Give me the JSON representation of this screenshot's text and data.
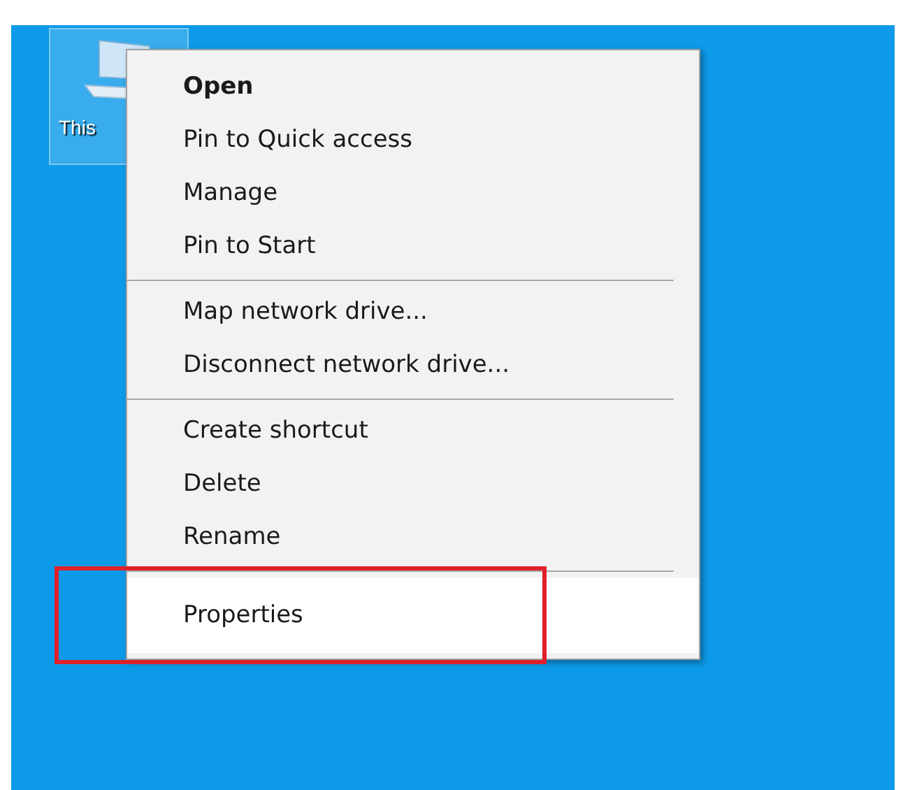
{
  "desktop_icon": {
    "label": "This",
    "selected": true
  },
  "context_menu": {
    "items": [
      {
        "kind": "item",
        "label": "Open",
        "default": true,
        "selected": false,
        "annotated": false
      },
      {
        "kind": "item",
        "label": "Pin to Quick access",
        "default": false,
        "selected": false,
        "annotated": false
      },
      {
        "kind": "item",
        "label": "Manage",
        "default": false,
        "selected": false,
        "annotated": false
      },
      {
        "kind": "item",
        "label": "Pin to Start",
        "default": false,
        "selected": false,
        "annotated": false
      },
      {
        "kind": "separator"
      },
      {
        "kind": "item",
        "label": "Map network drive...",
        "default": false,
        "selected": false,
        "annotated": false
      },
      {
        "kind": "item",
        "label": "Disconnect network drive...",
        "default": false,
        "selected": false,
        "annotated": false
      },
      {
        "kind": "separator"
      },
      {
        "kind": "item",
        "label": "Create shortcut",
        "default": false,
        "selected": false,
        "annotated": false
      },
      {
        "kind": "item",
        "label": "Delete",
        "default": false,
        "selected": false,
        "annotated": false
      },
      {
        "kind": "item",
        "label": "Rename",
        "default": false,
        "selected": false,
        "annotated": false
      },
      {
        "kind": "separator"
      },
      {
        "kind": "item",
        "label": "Properties",
        "default": false,
        "selected": true,
        "annotated": true
      }
    ]
  }
}
